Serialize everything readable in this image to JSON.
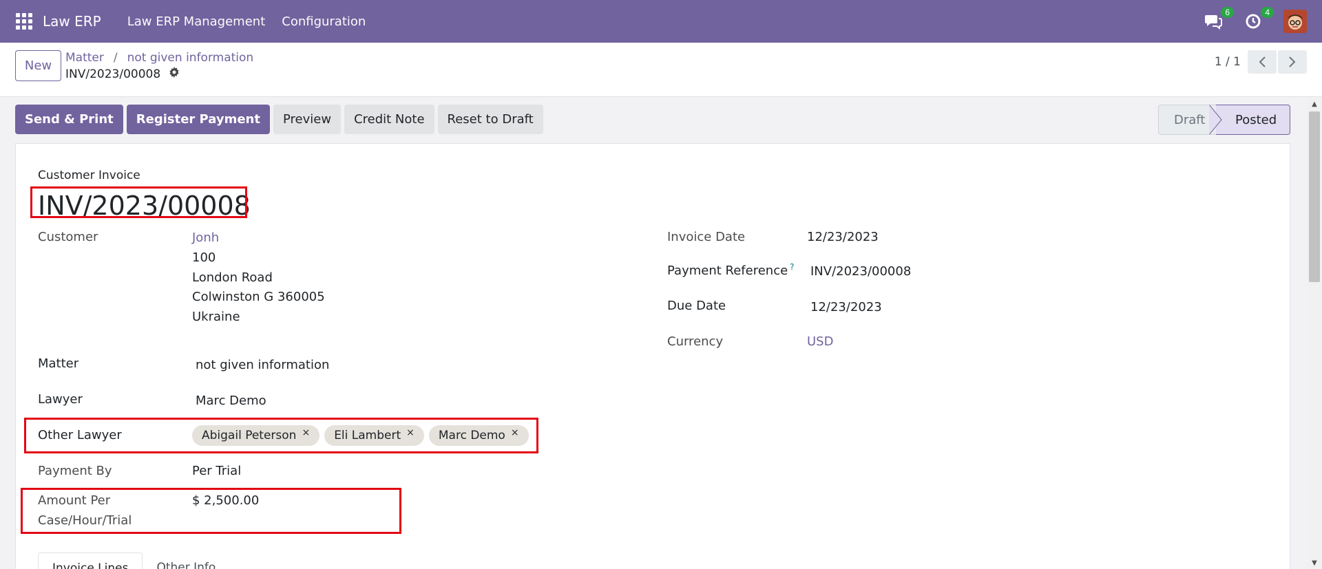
{
  "navbar": {
    "brand": "Law ERP",
    "menu": [
      "Law ERP Management",
      "Configuration"
    ],
    "messages_count": "6",
    "activities_count": "4"
  },
  "control": {
    "new_label": "New",
    "breadcrumb": [
      "Matter",
      "not given information"
    ],
    "record_name": "INV/2023/00008",
    "pager": "1 / 1"
  },
  "actions": {
    "send_print": "Send & Print",
    "register_payment": "Register Payment",
    "preview": "Preview",
    "credit_note": "Credit Note",
    "reset_draft": "Reset to Draft"
  },
  "stages": {
    "draft": "Draft",
    "posted": "Posted",
    "current": "Posted"
  },
  "invoice": {
    "type_label": "Customer Invoice",
    "number": "INV/2023/00008",
    "customer_label": "Customer",
    "customer": "Jonh",
    "address": [
      "100",
      "London Road",
      "Colwinston G 360005",
      "Ukraine"
    ],
    "matter_label": "Matter",
    "matter": "not given information",
    "lawyer_label": "Lawyer",
    "lawyer": "Marc Demo",
    "other_lawyer_label": "Other Lawyer",
    "other_lawyers": [
      "Abigail Peterson",
      "Eli Lambert",
      "Marc Demo"
    ],
    "payment_by_label": "Payment By",
    "payment_by": "Per Trial",
    "amount_label_1": "Amount Per",
    "amount_label_2": "Case/Hour/Trial",
    "amount": "$ 2,500.00",
    "invoice_date_label": "Invoice Date",
    "invoice_date": "12/23/2023",
    "payment_ref_label": "Payment Reference",
    "payment_ref_help": "?",
    "payment_ref": "INV/2023/00008",
    "due_date_label": "Due Date",
    "due_date": "12/23/2023",
    "currency_label": "Currency",
    "currency": "USD"
  },
  "tabs": [
    "Invoice Lines",
    "Other Info"
  ],
  "colors": {
    "brand": "#71639e",
    "highlight": "#e30613",
    "badge": "#28a745"
  }
}
